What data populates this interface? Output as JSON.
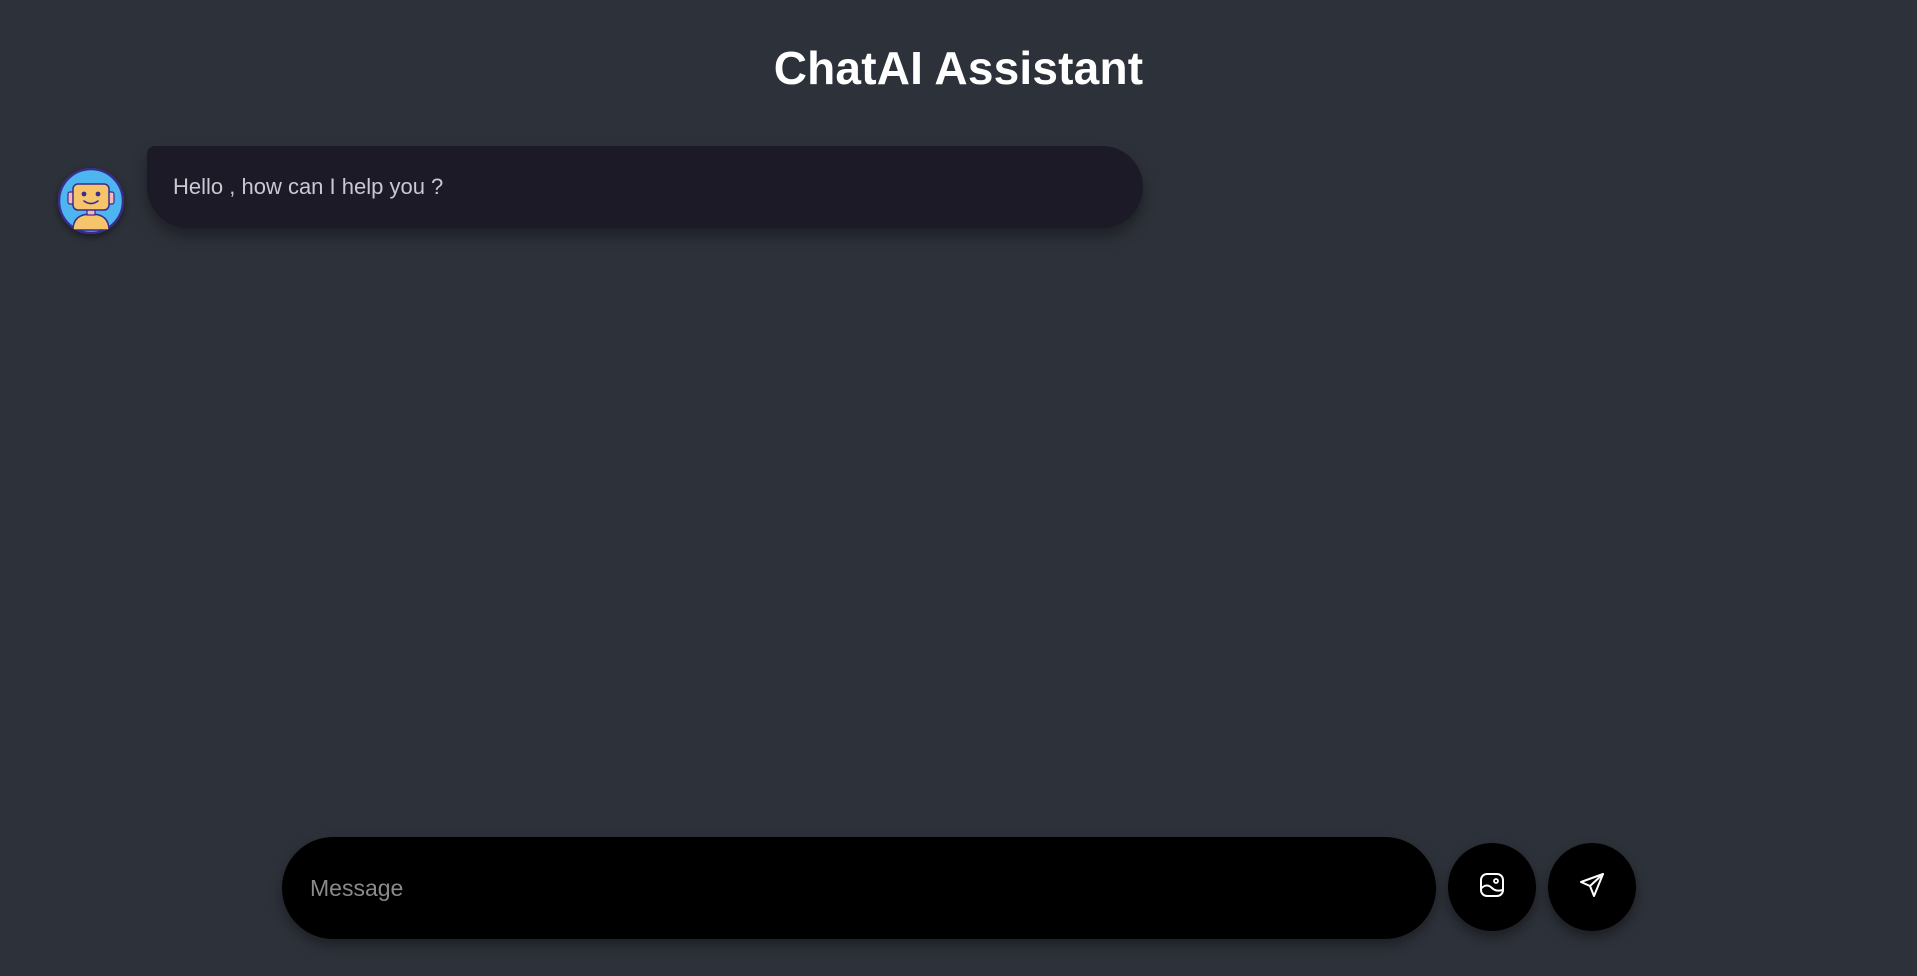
{
  "header": {
    "title": "ChatAI Assistant"
  },
  "messages": [
    {
      "sender": "assistant",
      "avatar_icon": "robot-avatar-icon",
      "text": "Hello , how can I help you ?"
    }
  ],
  "composer": {
    "placeholder": "Message",
    "value": "",
    "image_button_icon": "image-upload-icon",
    "send_button_icon": "send-icon"
  },
  "colors": {
    "background": "#2d3139",
    "bubble": "#1c1a27",
    "composer": "#000000",
    "title": "#ffffff"
  }
}
